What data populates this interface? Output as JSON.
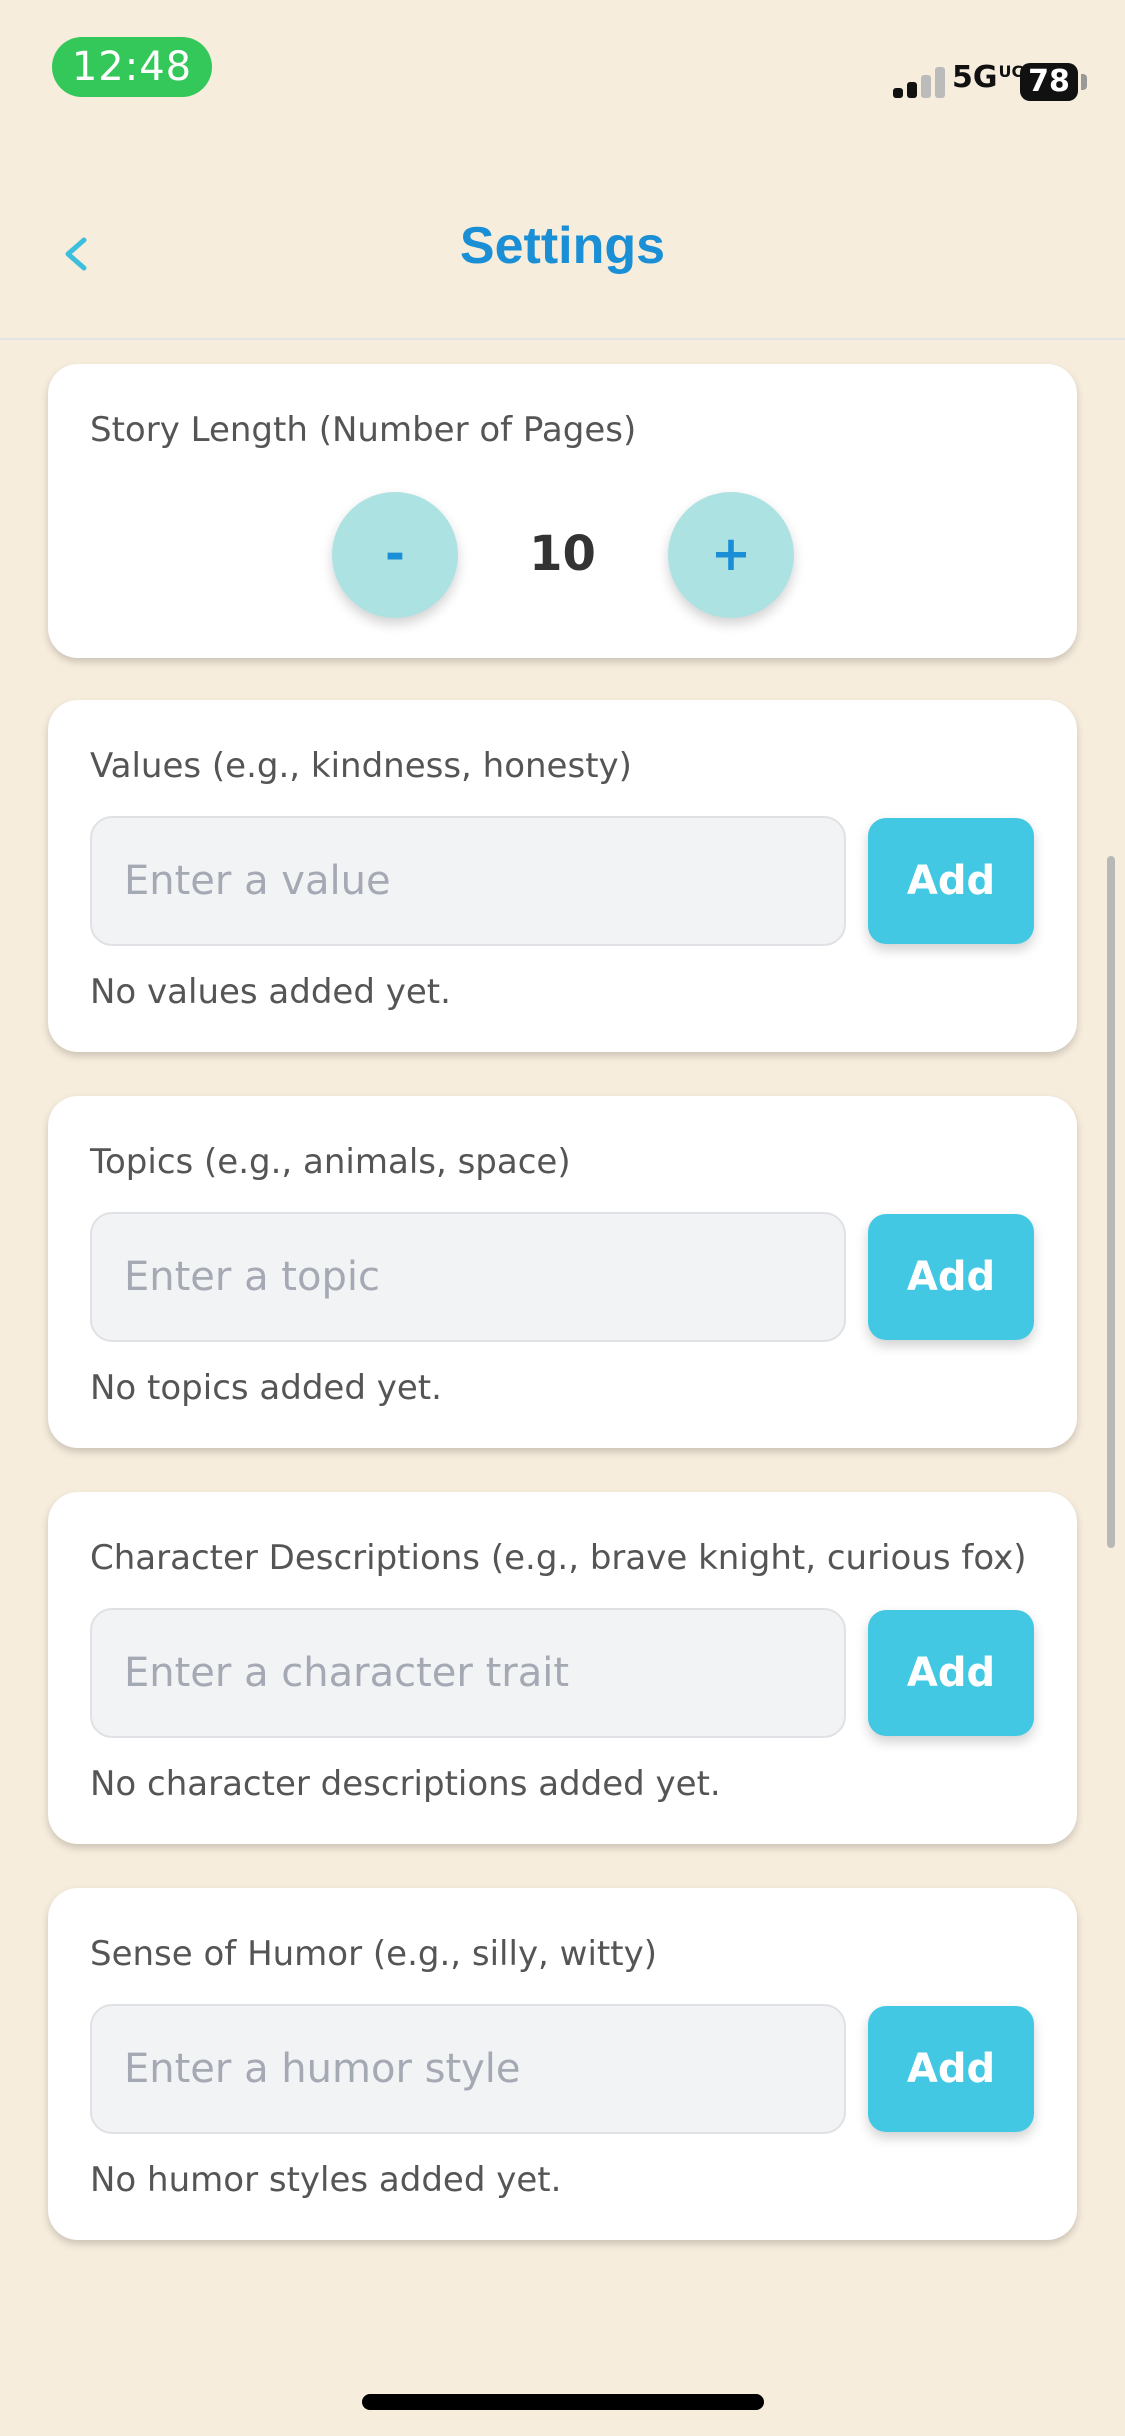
{
  "status_bar": {
    "time": "12:48",
    "network": "5G",
    "network_suffix": "UC",
    "battery": "78"
  },
  "header": {
    "title": "Settings",
    "back_icon": "chevron-left-icon"
  },
  "story_length": {
    "label": "Story Length (Number of Pages)",
    "value": "10",
    "decrement_label": "-",
    "increment_label": "+"
  },
  "sections": [
    {
      "label": "Values (e.g., kindness, honesty)",
      "placeholder": "Enter a value",
      "button": "Add",
      "empty": "No values added yet."
    },
    {
      "label": "Topics (e.g., animals, space)",
      "placeholder": "Enter a topic",
      "button": "Add",
      "empty": "No topics added yet."
    },
    {
      "label": "Character Descriptions (e.g., brave knight, curious fox)",
      "placeholder": "Enter a character trait",
      "button": "Add",
      "empty": "No character descriptions added yet."
    },
    {
      "label": "Sense of Humor (e.g., silly, witty)",
      "placeholder": "Enter a humor style",
      "button": "Add",
      "empty": "No humor styles added yet."
    }
  ],
  "colors": {
    "accent": "#1a8fd6",
    "button": "#43c8e3",
    "stepper": "#ade2e3",
    "background": "#f7eddd",
    "status_green": "#34c759"
  }
}
